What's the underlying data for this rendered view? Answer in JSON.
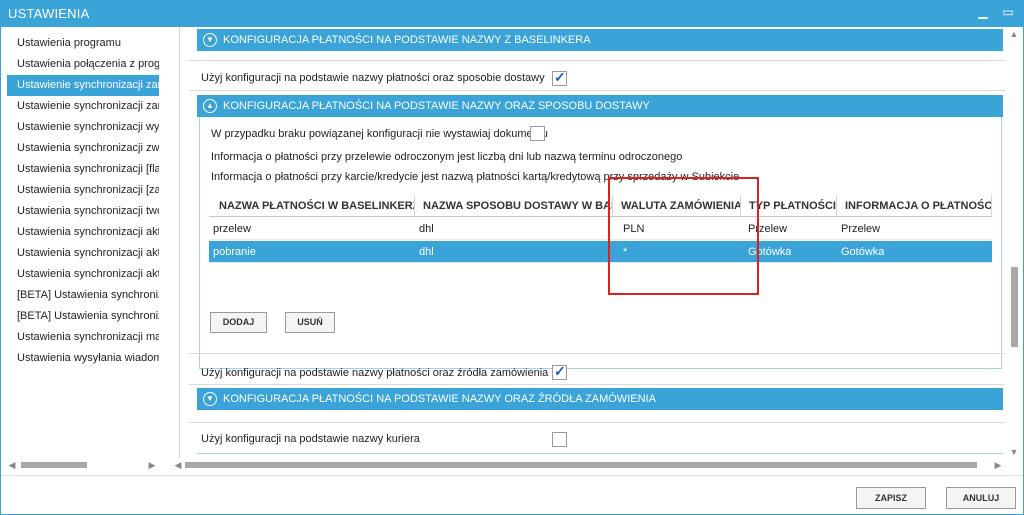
{
  "window": {
    "title": "USTAWIENIA"
  },
  "sidebar": {
    "items": [
      {
        "label": "Ustawienia programu"
      },
      {
        "label": "Ustawienia połączenia z progra"
      },
      {
        "label": "Ustawienie synchronizacji zamó"
      },
      {
        "label": "Ustawienie synchronizacji zamó"
      },
      {
        "label": "Ustawienie synchronizacji wysy"
      },
      {
        "label": "Ustawienia synchronizacji zwrot"
      },
      {
        "label": "Ustawienia synchronizacji [flaga"
      },
      {
        "label": "Ustawienia synchronizacji [zamó"
      },
      {
        "label": "Ustawienia synchronizacji tworz"
      },
      {
        "label": "Ustawienia synchronizacji aktua"
      },
      {
        "label": "Ustawienia synchronizacji aktua"
      },
      {
        "label": "Ustawienia synchronizacji aktua"
      },
      {
        "label": "[BETA] Ustawienia synchronizac"
      },
      {
        "label": "[BETA] Ustawienia synchronizac"
      },
      {
        "label": "Ustawienia synchronizacji maga"
      },
      {
        "label": "Ustawienia wysyłania wiadomo"
      }
    ],
    "selected_index": 2
  },
  "main": {
    "section1_header": "KONFIGURACJA PŁATNOŚCI NA PODSTAWIE NAZWY Z BASELINKERA",
    "use_config_delivery_label": "Użyj konfiguracji na podstawie nazwy płatności oraz sposobie dostawy",
    "use_config_delivery_checked": true,
    "section2_header": "KONFIGURACJA PŁATNOŚCI NA PODSTAWIE NAZWY ORAZ SPOSOBU DOSTAWY",
    "no_config_label": "W przypadku braku powiązanej konfiguracji nie wystawiaj dokumentu",
    "no_config_checked": false,
    "info_transfer": "Informacja o płatności przy przelewie odroczonym jest liczbą dni lub nazwą terminu odroczonego",
    "info_card": "Informacja o płatności przy karcie/kredycie jest nazwą płatności kartą/kredytową przy sprzedaży w Subiekcie",
    "table": {
      "columns": [
        "NAZWA PŁATNOŚCI W BASELINKERZE",
        "NAZWA SPOSOBU DOSTAWY W BASELI",
        "WALUTA ZAMÓWIENIA",
        "TYP PŁATNOŚCI",
        "INFORMACJA O PŁATNOŚCI"
      ],
      "rows": [
        {
          "payment_name": "przelew",
          "delivery": "dhl",
          "currency": "PLN",
          "type": "Przelew",
          "info": "Przelew"
        },
        {
          "payment_name": "pobranie",
          "delivery": "dhl",
          "currency": "*",
          "type": "Gotówka",
          "info": "Gotówka"
        }
      ],
      "selected_row": 1
    },
    "add_button": "DODAJ",
    "remove_button": "USUŃ",
    "use_config_source_label": "Użyj konfiguracji na podstawie nazwy płatności oraz źródła zamówienia",
    "use_config_source_checked": true,
    "section3_header": "KONFIGURACJA PŁATNOŚCI NA PODSTAWIE NAZWY ORAZ ŹRÓDŁA ZAMÓWIENIA",
    "use_config_courier_label": "Użyj konfiguracji na podstawie nazwy kuriera",
    "use_config_courier_checked": false
  },
  "footer": {
    "save_button": "ZAPISZ",
    "cancel_button": "ANULUJ"
  },
  "colors": {
    "accent": "#3aa3d8",
    "highlight_box": "#e02020"
  }
}
